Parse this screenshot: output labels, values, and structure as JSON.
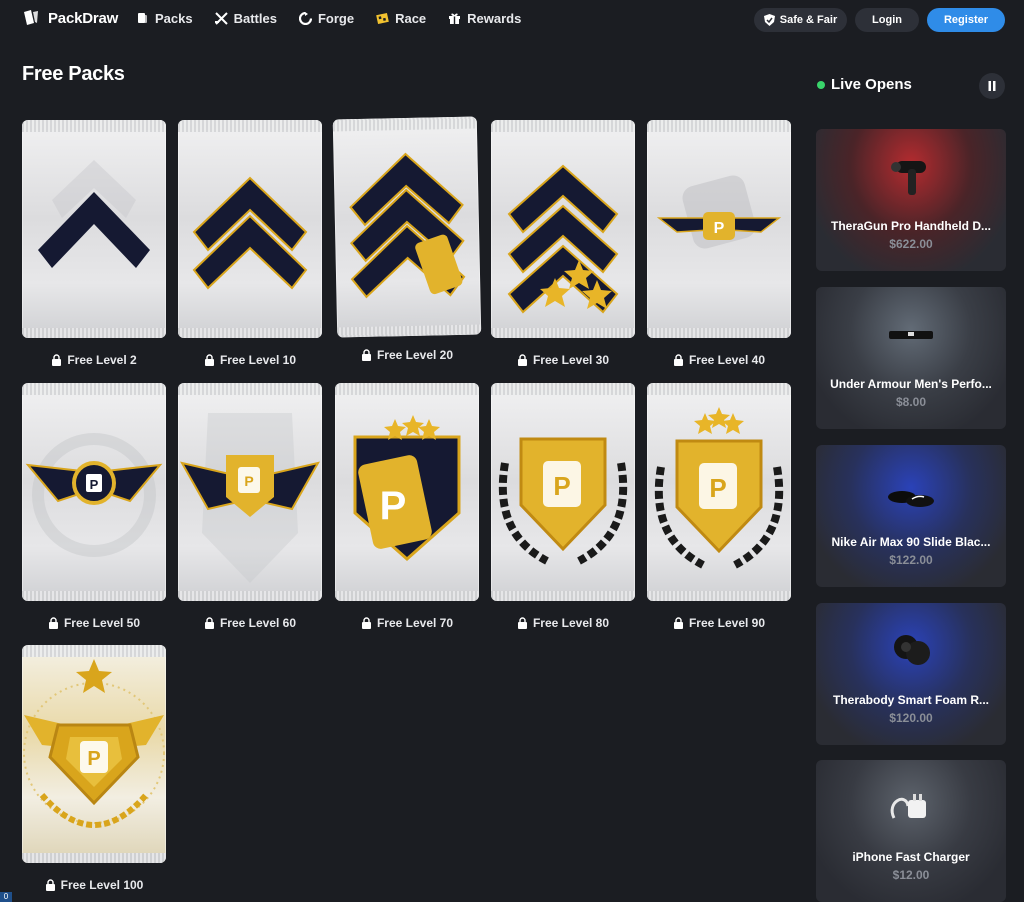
{
  "nav": {
    "brand": "PackDraw",
    "links": [
      {
        "label": "Packs",
        "icon": "cards-icon"
      },
      {
        "label": "Battles",
        "icon": "swords-icon"
      },
      {
        "label": "Forge",
        "icon": "forge-icon"
      },
      {
        "label": "Race",
        "icon": "race-flag-icon"
      },
      {
        "label": "Rewards",
        "icon": "gift-icon"
      }
    ],
    "safe_fair": "Safe & Fair",
    "login": "Login",
    "register": "Register"
  },
  "page": {
    "title": "Free Packs"
  },
  "packs": [
    {
      "label": "Free Level 2",
      "emblem": "chevron-one"
    },
    {
      "label": "Free Level 10",
      "emblem": "chevron-two"
    },
    {
      "label": "Free Level 20",
      "emblem": "chevron-three"
    },
    {
      "label": "Free Level 30",
      "emblem": "chevron-three-stars"
    },
    {
      "label": "Free Level 40",
      "emblem": "wings-small"
    },
    {
      "label": "Free Level 50",
      "emblem": "wings-coin"
    },
    {
      "label": "Free Level 60",
      "emblem": "wings-shield"
    },
    {
      "label": "Free Level 70",
      "emblem": "shield-stars"
    },
    {
      "label": "Free Level 80",
      "emblem": "laurel-shield"
    },
    {
      "label": "Free Level 90",
      "emblem": "laurel-shield-stars"
    },
    {
      "label": "Free Level 100",
      "emblem": "gold-crest"
    }
  ],
  "live": {
    "title": "Live Opens",
    "items": [
      {
        "name": "TheraGun Pro Handheld D...",
        "price": "$622.00",
        "glow": "#c0292c"
      },
      {
        "name": "Under Armour Men's Perfo...",
        "price": "$8.00",
        "glow": "#6e7884"
      },
      {
        "name": "Nike Air Max 90 Slide Blac...",
        "price": "$122.00",
        "glow": "#2a46c9"
      },
      {
        "name": "Therabody Smart Foam R...",
        "price": "$120.00",
        "glow": "#2a46c9"
      },
      {
        "name": "iPhone Fast Charger",
        "price": "$12.00",
        "glow": "#6e7884"
      }
    ]
  },
  "colors": {
    "accent": "#2f8ce8",
    "live": "#39d46b",
    "gold": "#d9a51c",
    "navy": "#161a33"
  },
  "corner_tag": "0"
}
